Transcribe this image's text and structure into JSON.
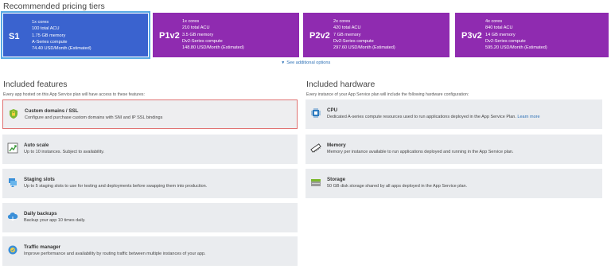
{
  "tiers_section": {
    "title": "Recommended pricing tiers"
  },
  "tiers": [
    {
      "name": "S1",
      "lines": [
        "1x cores",
        "100 total ACU",
        "1.75 GB memory",
        "A-Series compute",
        "74.40 USD/Month (Estimated)"
      ],
      "selected": true,
      "color": "#3a63cf"
    },
    {
      "name": "P1v2",
      "lines": [
        "1x cores",
        "210 total ACU",
        "3.5 GB memory",
        "Dv2-Series compute",
        "148.80 USD/Month (Estimated)"
      ],
      "selected": false,
      "color": "#8f2bb0"
    },
    {
      "name": "P2v2",
      "lines": [
        "2x cores",
        "420 total ACU",
        "7 GB memory",
        "Dv2-Series compute",
        "297.60 USD/Month (Estimated)"
      ],
      "selected": false,
      "color": "#8f2bb0"
    },
    {
      "name": "P3v2",
      "lines": [
        "4x cores",
        "840 total ACU",
        "14 GB memory",
        "Dv2-Series compute",
        "595.20 USD/Month (Estimated)"
      ],
      "selected": false,
      "color": "#8f2bb0"
    }
  ],
  "see_more": {
    "label": "See additional options"
  },
  "features": {
    "title": "Included features",
    "subtitle": "Every app hosted on this App Service plan will have access to these features:",
    "items": [
      {
        "icon": "ssl-shield-icon",
        "title": "Custom domains / SSL",
        "desc": "Configure and purchase custom domains with SNI and IP SSL bindings",
        "selected": true
      },
      {
        "icon": "auto-scale-icon",
        "title": "Auto scale",
        "desc": "Up to 10 instances. Subject to availability."
      },
      {
        "icon": "staging-slots-icon",
        "title": "Staging slots",
        "desc": "Up to 5 staging slots to use for testing and deployments before swapping them into production."
      },
      {
        "icon": "daily-backups-icon",
        "title": "Daily backups",
        "desc": "Backup your app 10 times daily."
      },
      {
        "icon": "traffic-manager-icon",
        "title": "Traffic manager",
        "desc": "Improve performance and availability by routing traffic between multiple instances of your app."
      }
    ]
  },
  "hardware": {
    "title": "Included hardware",
    "subtitle": "Every instance of your App Service plan will include the following hardware configuration:",
    "items": [
      {
        "icon": "cpu-icon",
        "title": "CPU",
        "desc": "Dedicated A-series compute resources used to run applications deployed in the App Service Plan.",
        "link": "Learn more"
      },
      {
        "icon": "memory-icon",
        "title": "Memory",
        "desc": "Memory per instance available to run applications deployed and running in the App Service plan."
      },
      {
        "icon": "storage-icon",
        "title": "Storage",
        "desc": "50 GB disk storage shared by all apps deployed in the App Service plan."
      }
    ]
  }
}
